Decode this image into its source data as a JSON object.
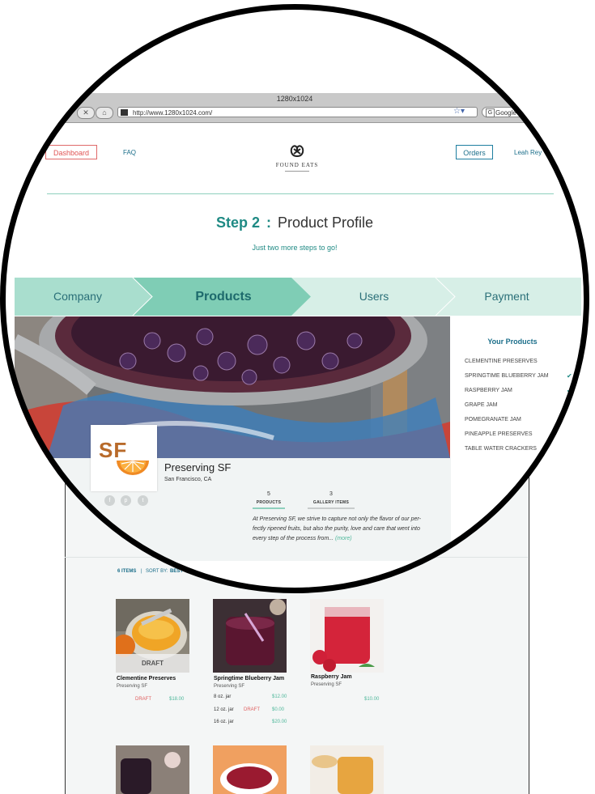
{
  "browser": {
    "window_title": "1280x1024",
    "url": "http://www.1280x1024.com/",
    "search_placeholder": "Google"
  },
  "header": {
    "dashboard_label": "Dashboard",
    "faq_label": "FAQ",
    "logo_text": "FOUND EATS",
    "orders_label": "Orders",
    "user_name": "Leah Rey"
  },
  "step": {
    "number": "Step 2",
    "colon": ":",
    "name": "Product Profile",
    "subtitle": "Just two more steps to go!"
  },
  "progress": [
    {
      "label": "Company",
      "state": "done"
    },
    {
      "label": "Products",
      "state": "active"
    },
    {
      "label": "Users",
      "state": "pending"
    },
    {
      "label": "Payment",
      "state": "pending"
    }
  ],
  "sidebar": {
    "title": "Your Products",
    "items": [
      {
        "label": "CLEMENTINE PRESERVES",
        "checked": false
      },
      {
        "label": "SPRINGTIME BLUEBERRY JAM",
        "checked": true
      },
      {
        "label": "RASPBERRY JAM",
        "checked": true
      },
      {
        "label": "GRAPE JAM",
        "checked": true
      },
      {
        "label": "POMEGRANATE JAM",
        "checked": false
      },
      {
        "label": "PINEAPPLE PRESERVES",
        "checked": false
      },
      {
        "label": "TABLE WATER CRACKERS",
        "checked": false
      }
    ]
  },
  "profile": {
    "logo_text": "SF",
    "name": "Preserving SF",
    "location": "San Francisco, CA",
    "stats": [
      {
        "value": "5",
        "label": "PRODUCTS"
      },
      {
        "value": "3",
        "label": "GALLERY ITEMS"
      }
    ],
    "description": "At Preserving SF, we strive to capture not only the flavor of our per-fectly ripened fruits, but also the purity, love and care that went into every step of the process from...",
    "more_label": "(more)"
  },
  "items_bar": {
    "count": "6 ITEMS",
    "separator": "|",
    "sort_label": "SORT BY:",
    "sort_value": "BEST"
  },
  "products": [
    {
      "name": "Clementine Preserves",
      "seller": "Preserving SF",
      "overlay": "DRAFT",
      "status": "DRAFT",
      "price": "$18.00"
    },
    {
      "name": "Springtime Blueberry Jam",
      "seller": "Preserving SF",
      "variants": [
        {
          "size": "8 oz. jar",
          "status": "",
          "price": "$12.00"
        },
        {
          "size": "12 oz. jar",
          "status": "DRAFT",
          "price": "$0.00"
        },
        {
          "size": "16 oz. jar",
          "status": "",
          "price": "$20.00"
        }
      ]
    },
    {
      "name": "Raspberry Jam",
      "seller": "Preserving SF",
      "price": "$10.00"
    }
  ],
  "colors": {
    "teal": "#1f8a84",
    "step_active": "#7fcdb5",
    "step_pending": "#d7efe7",
    "draft_red": "#e06060",
    "price_green": "#4fb89b"
  }
}
